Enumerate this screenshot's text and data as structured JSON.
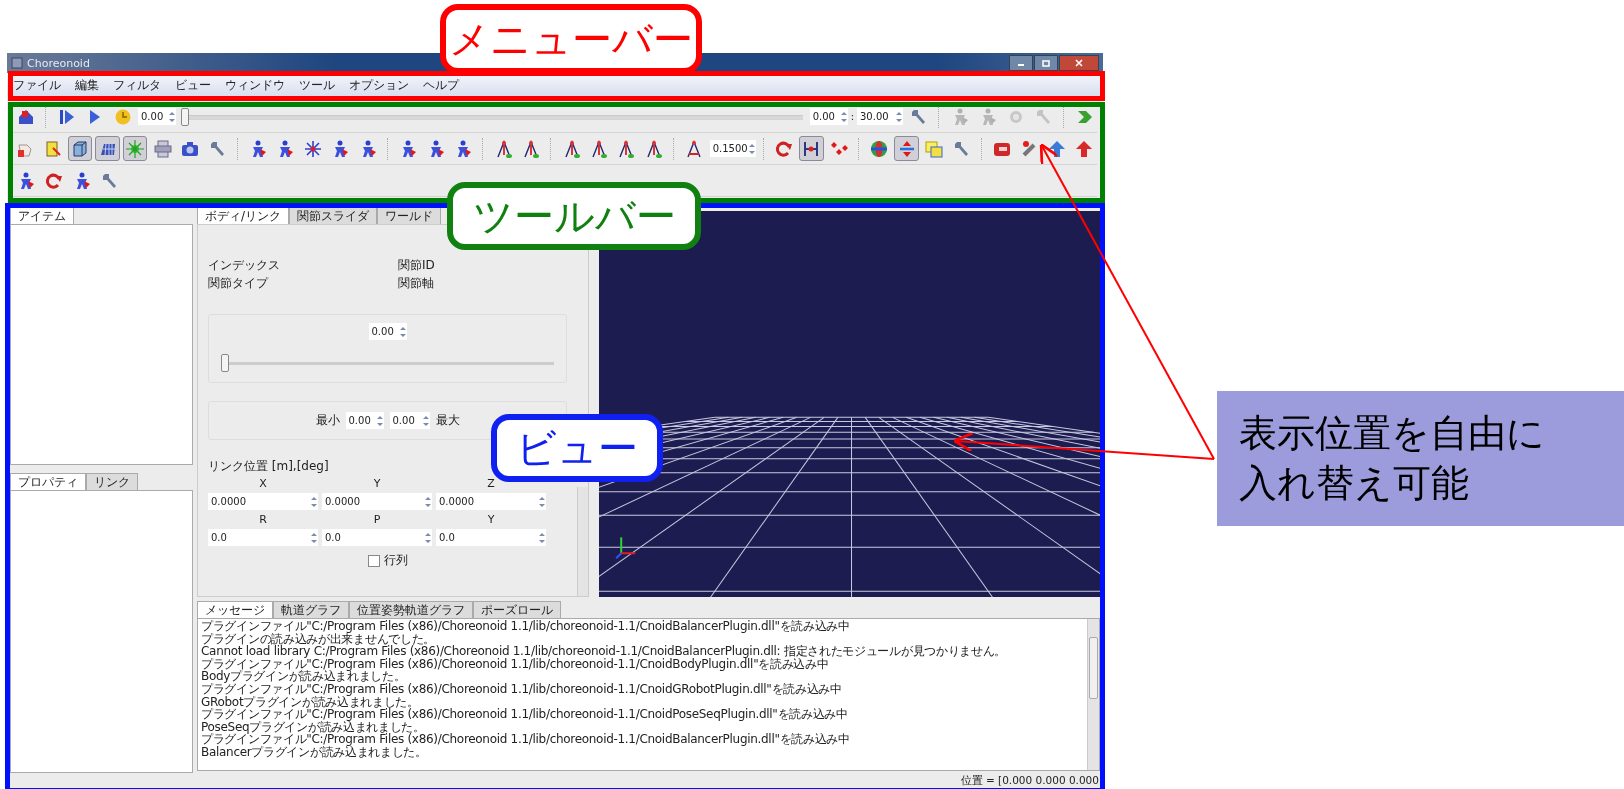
{
  "callouts": [
    {
      "text": "メニューバー",
      "kind": "menu"
    },
    {
      "text": "ツールバー",
      "kind": "toolbar"
    },
    {
      "text": "ビュー",
      "kind": "view"
    }
  ],
  "note": {
    "lines": [
      "表示位置を自由に",
      "入れ替え可能"
    ]
  },
  "window": {
    "title": "Choreonoid"
  },
  "menu_bar": {
    "items": [
      "ファイル",
      "編集",
      "フィルタ",
      "ビュー",
      "ウィンドウ",
      "ツール",
      "オプション",
      "ヘルプ"
    ]
  },
  "toolbar": {
    "rows": [
      {
        "items": [
          {
            "kind": "button",
            "pressed": false,
            "disabled": false
          },
          {
            "kind": "separator"
          },
          {
            "kind": "button",
            "pressed": false,
            "disabled": false
          },
          {
            "kind": "button",
            "pressed": false,
            "disabled": false
          },
          {
            "kind": "button",
            "pressed": false,
            "disabled": false
          },
          {
            "kind": "spin",
            "value": "0.00"
          },
          {
            "kind": "slider",
            "level": 0
          },
          {
            "kind": "spin",
            "value": "0.00"
          },
          {
            "kind": "label",
            "text": ":"
          },
          {
            "kind": "spin",
            "value": "30.00"
          },
          {
            "kind": "button",
            "pressed": false,
            "disabled": false
          },
          {
            "kind": "separator"
          },
          {
            "kind": "button",
            "pressed": false,
            "disabled": true
          },
          {
            "kind": "button",
            "pressed": false,
            "disabled": true
          },
          {
            "kind": "button",
            "pressed": false,
            "disabled": true
          },
          {
            "kind": "button",
            "pressed": false,
            "disabled": true
          },
          {
            "kind": "separator"
          },
          {
            "kind": "button",
            "pressed": false,
            "disabled": false
          }
        ]
      },
      {
        "items": [
          {
            "kind": "button",
            "pressed": false,
            "disabled": false
          },
          {
            "kind": "button",
            "pressed": false,
            "disabled": false
          },
          {
            "kind": "button",
            "pressed": true,
            "disabled": false
          },
          {
            "kind": "button",
            "pressed": true,
            "disabled": false
          },
          {
            "kind": "button",
            "pressed": true,
            "disabled": false
          },
          {
            "kind": "button",
            "pressed": false,
            "disabled": false
          },
          {
            "kind": "button",
            "pressed": false,
            "disabled": false
          },
          {
            "kind": "button",
            "pressed": false,
            "disabled": false
          },
          {
            "kind": "separator"
          },
          {
            "kind": "button",
            "pressed": false,
            "disabled": false
          },
          {
            "kind": "button",
            "pressed": false,
            "disabled": false
          },
          {
            "kind": "button",
            "pressed": false,
            "disabled": false
          },
          {
            "kind": "button",
            "pressed": false,
            "disabled": false
          },
          {
            "kind": "button",
            "pressed": false,
            "disabled": false
          },
          {
            "kind": "separator"
          },
          {
            "kind": "button",
            "pressed": false,
            "disabled": false
          },
          {
            "kind": "button",
            "pressed": false,
            "disabled": false
          },
          {
            "kind": "button",
            "pressed": false,
            "disabled": false
          },
          {
            "kind": "separator"
          },
          {
            "kind": "button",
            "pressed": false,
            "disabled": false
          },
          {
            "kind": "button",
            "pressed": false,
            "disabled": false
          },
          {
            "kind": "separator"
          },
          {
            "kind": "button",
            "pressed": false,
            "disabled": false
          },
          {
            "kind": "button",
            "pressed": false,
            "disabled": false
          },
          {
            "kind": "button",
            "pressed": false,
            "disabled": false
          },
          {
            "kind": "button",
            "pressed": false,
            "disabled": false
          },
          {
            "kind": "separator"
          },
          {
            "kind": "button",
            "pressed": false,
            "disabled": false
          },
          {
            "kind": "spin",
            "value": "0.1500"
          },
          {
            "kind": "separator"
          },
          {
            "kind": "button",
            "pressed": false,
            "disabled": false
          },
          {
            "kind": "button",
            "pressed": true,
            "disabled": false
          },
          {
            "kind": "button",
            "pressed": false,
            "disabled": false
          },
          {
            "kind": "separator"
          },
          {
            "kind": "button",
            "pressed": false,
            "disabled": false
          },
          {
            "kind": "button",
            "pressed": true,
            "disabled": false
          },
          {
            "kind": "button",
            "pressed": false,
            "disabled": false
          },
          {
            "kind": "button",
            "pressed": false,
            "disabled": false
          },
          {
            "kind": "separator"
          },
          {
            "kind": "button",
            "pressed": false,
            "disabled": false
          },
          {
            "kind": "button",
            "pressed": false,
            "disabled": false
          },
          {
            "kind": "button",
            "pressed": false,
            "disabled": false
          },
          {
            "kind": "button",
            "pressed": false,
            "disabled": false
          }
        ]
      },
      {
        "items": [
          {
            "kind": "button",
            "pressed": false,
            "disabled": false
          },
          {
            "kind": "button",
            "pressed": false,
            "disabled": false
          },
          {
            "kind": "button",
            "pressed": false,
            "disabled": false
          },
          {
            "kind": "button",
            "pressed": false,
            "disabled": false
          }
        ]
      }
    ]
  },
  "item_view": {
    "tabs": [
      {
        "label": "アイテム",
        "selected": true
      }
    ]
  },
  "property_view": {
    "tabs": [
      {
        "label": "プロパティ",
        "selected": true
      },
      {
        "label": "リンク",
        "selected": false
      }
    ]
  },
  "body_link_view": {
    "tabs": [
      {
        "label": "ボディ/リンク",
        "selected": true
      },
      {
        "label": "関節スライダ",
        "selected": false
      },
      {
        "label": "ワールド",
        "selected": false
      }
    ],
    "info": [
      {
        "label": "インデックス"
      },
      {
        "label": "関節ID"
      },
      {
        "label": "関節タイプ"
      },
      {
        "label": "関節軸"
      }
    ],
    "joint_value": "0.00",
    "joint_slider": {
      "level": 0
    },
    "min_label": "最小",
    "min_value": "0.00",
    "max_value": "0.00",
    "max_label": "最大",
    "position_title": "リンク位置 [m],[deg]",
    "position_headers": [
      "X",
      "Y",
      "Z"
    ],
    "position_values": [
      "0.0000",
      "0.0000",
      "0.0000"
    ],
    "rotation_headers": [
      "R",
      "P",
      "Y"
    ],
    "rotation_values": [
      "0.0",
      "0.0",
      "0.0"
    ],
    "matrix_checkbox": {
      "label": "行列",
      "checked": false
    }
  },
  "message_view": {
    "tabs": [
      {
        "label": "メッセージ",
        "selected": true
      },
      {
        "label": "軌道グラフ",
        "selected": false
      },
      {
        "label": "位置姿勢軌道グラフ",
        "selected": false
      },
      {
        "label": "ポーズロール",
        "selected": false
      }
    ],
    "lines": [
      "プラグインファイル\"C:/Program Files (x86)/Choreonoid 1.1/lib/choreonoid-1.1/CnoidBalancerPlugin.dll\"を読み込み中",
      "プラグインの読み込みが出来ませんでした。",
      "Cannot load library C:/Program Files (x86)/Choreonoid 1.1/lib/choreonoid-1.1/CnoidBalancerPlugin.dll: 指定されたモジュールが見つかりません。",
      "プラグインファイル\"C:/Program Files (x86)/Choreonoid 1.1/lib/choreonoid-1.1/CnoidBodyPlugin.dll\"を読み込み中",
      "Bodyプラグインが読み込まれました。",
      "プラグインファイル\"C:/Program Files (x86)/Choreonoid 1.1/lib/choreonoid-1.1/CnoidGRobotPlugin.dll\"を読み込み中",
      "GRobotプラグインが読み込まれました。",
      "プラグインファイル\"C:/Program Files (x86)/Choreonoid 1.1/lib/choreonoid-1.1/CnoidPoseSeqPlugin.dll\"を読み込み中",
      "PoseSeqプラグインが読み込まれました。",
      "プラグインファイル\"C:/Program Files (x86)/Choreonoid 1.1/lib/choreonoid-1.1/CnoidBalancerPlugin.dll\"を読み込み中",
      "Balancerプラグインが読み込まれました。"
    ]
  },
  "status_bar": {
    "text": "位置 = [0.000 0.000 0.000"
  }
}
